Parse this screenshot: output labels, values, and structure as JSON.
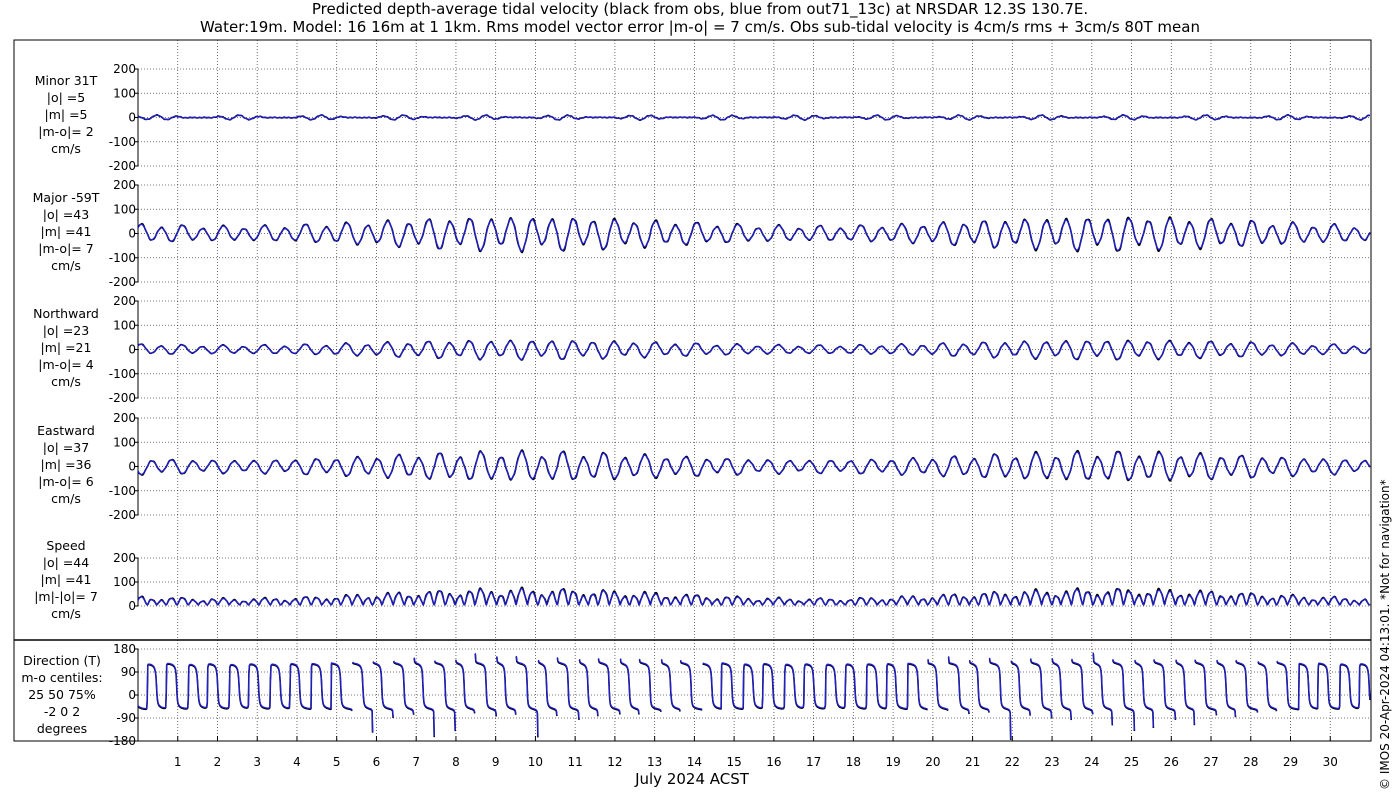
{
  "title_line1": "Predicted depth-average tidal velocity (black from obs, blue from out71_13c) at NRSDAR 12.3S 130.7E.",
  "title_line2": "Water:19m. Model: 16 16m at 1 1km. Rms model vector error |m-o| = 7 cm/s. Obs sub-tidal velocity is 4cm/s rms + 3cm/s 80T mean",
  "xlabel": "July 2024 ACST",
  "copyright": "© IMOS 20-Apr-2024 04:13:01. *Not for navigation*",
  "colors": {
    "obs": "#000000",
    "model": "#1f1fd6",
    "axis": "#000000",
    "grid": "#000000"
  },
  "chart_data": {
    "type": "line",
    "x_domain_days": [
      0,
      31
    ],
    "x_ticks": [
      1,
      2,
      3,
      4,
      5,
      6,
      7,
      8,
      9,
      10,
      11,
      12,
      13,
      14,
      15,
      16,
      17,
      18,
      19,
      20,
      21,
      22,
      23,
      24,
      25,
      26,
      27,
      28,
      29,
      30
    ],
    "grid": true,
    "series_legend": [
      {
        "name": "obs",
        "color": "#000000"
      },
      {
        "name": "model",
        "color": "#1f1fd6"
      }
    ],
    "panels": [
      {
        "id": "minor",
        "label_lines": [
          "Minor 31T",
          "|o| =5",
          "|m| =5",
          "|m-o|= 2",
          "cm/s"
        ],
        "ylim": [
          -200,
          200
        ],
        "yticks": [
          "200",
          "100",
          "0",
          "-100",
          "-200"
        ],
        "ytick_values": [
          200,
          100,
          0,
          -100,
          -200
        ],
        "approx_amplitude": 5,
        "kind": "minor"
      },
      {
        "id": "major",
        "label_lines": [
          "Major -59T",
          "|o| =43",
          "|m| =41",
          "|m-o|= 7",
          "cm/s"
        ],
        "ylim": [
          -200,
          200
        ],
        "yticks": [
          "200",
          "100",
          "0",
          "-100",
          "-200"
        ],
        "ytick_values": [
          200,
          100,
          0,
          -100,
          -200
        ],
        "approx_amplitude": 43,
        "kind": "major"
      },
      {
        "id": "north",
        "label_lines": [
          "Northward",
          "|o| =23",
          "|m| =21",
          "|m-o|= 4",
          "cm/s"
        ],
        "ylim": [
          -200,
          200
        ],
        "yticks": [
          "200",
          "100",
          "0",
          "-100",
          "-200"
        ],
        "ytick_values": [
          200,
          100,
          0,
          -100,
          -200
        ],
        "approx_amplitude": 23,
        "kind": "north"
      },
      {
        "id": "east",
        "label_lines": [
          "Eastward",
          "|o| =37",
          "|m| =36",
          "|m-o|= 6",
          "cm/s"
        ],
        "ylim": [
          -200,
          200
        ],
        "yticks": [
          "200",
          "100",
          "0",
          "-100",
          "-200"
        ],
        "ytick_values": [
          200,
          100,
          0,
          -100,
          -200
        ],
        "approx_amplitude": 37,
        "kind": "east"
      },
      {
        "id": "speed",
        "label_lines": [
          "Speed",
          "|o| =44",
          "|m| =41",
          "|m|-|o|= 7",
          "cm/s"
        ],
        "ylim": [
          0,
          200
        ],
        "yticks": [
          "200",
          "100",
          "0"
        ],
        "ytick_values": [
          200,
          100,
          0
        ],
        "approx_amplitude": 44,
        "kind": "speed"
      },
      {
        "id": "direction",
        "label_lines": [
          "Direction (T)",
          "m-o centiles:",
          "25  50  75%",
          "-2  0  2",
          "degrees"
        ],
        "ylim": [
          -180,
          180
        ],
        "yticks": [
          "180",
          "90",
          "0",
          "-90",
          "-180"
        ],
        "ytick_values": [
          180,
          90,
          0,
          -90,
          -180
        ],
        "kind": "direction"
      }
    ]
  }
}
